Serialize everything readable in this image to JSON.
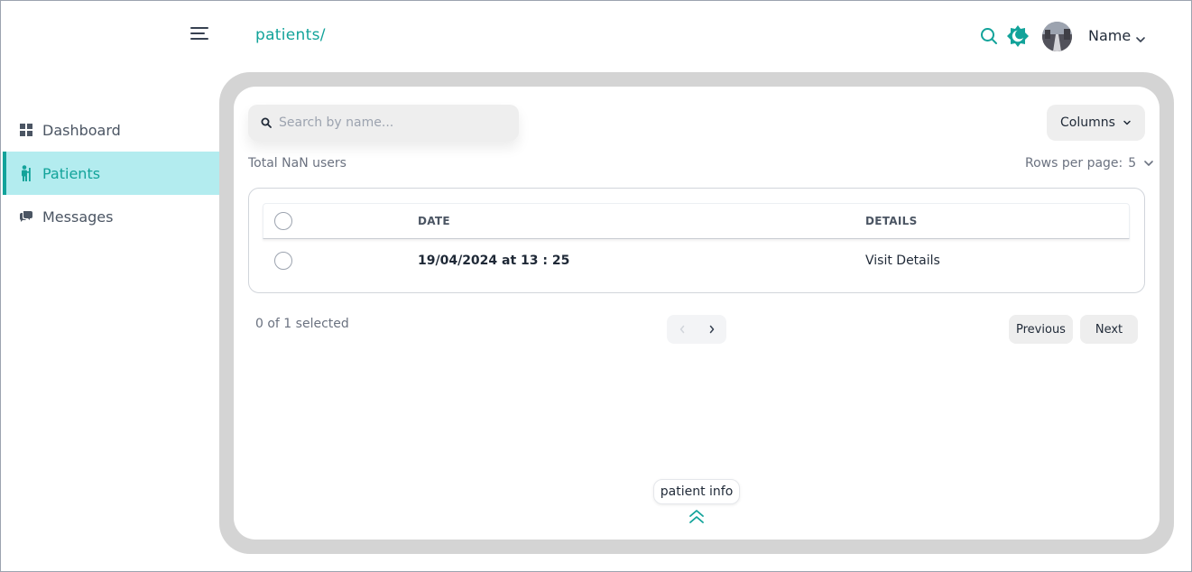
{
  "header": {
    "breadcrumb": "patients/",
    "user_name": "Name",
    "icons": [
      "menu-icon",
      "search-icon",
      "theme-toggle-icon",
      "avatar",
      "chevron-down-icon"
    ]
  },
  "sidebar": {
    "items": [
      {
        "label": "Dashboard",
        "icon": "dashboard-grid-icon",
        "active": false
      },
      {
        "label": "Patients",
        "icon": "patient-icon",
        "active": true
      },
      {
        "label": "Messages",
        "icon": "chat-icon",
        "active": false
      }
    ]
  },
  "main": {
    "search": {
      "placeholder": "Search by name...",
      "value": ""
    },
    "columns_label": "Columns",
    "total_text": "Total NaN users",
    "rows_per_page_label": "Rows per page:",
    "rows_per_page_value": "5",
    "table": {
      "headers": [
        "DATE",
        "DETAILS"
      ],
      "rows": [
        {
          "date": "19/04/2024 at 13 : 25",
          "details": "Visit Details"
        }
      ]
    },
    "selected_text": "0 of 1 selected",
    "previous_label": "Previous",
    "next_label": "Next",
    "patient_info_label": "patient info"
  },
  "colors": {
    "accent": "#12a39a",
    "active_bg": "#b3ecef",
    "frame": "#d4d4d4"
  }
}
